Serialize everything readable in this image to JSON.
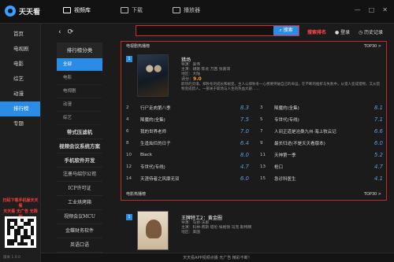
{
  "app": {
    "title": "天天看"
  },
  "nav": {
    "tabs": [
      {
        "label": "视频库",
        "active": true
      },
      {
        "label": "下载",
        "active": false
      },
      {
        "label": "播放器",
        "active": false
      }
    ]
  },
  "window": {
    "controls": [
      "—",
      "□",
      "✕"
    ]
  },
  "sidebar": {
    "items": [
      {
        "label": "首页"
      },
      {
        "label": "电视剧"
      },
      {
        "label": "电影"
      },
      {
        "label": "综艺"
      },
      {
        "label": "动漫"
      },
      {
        "label": "排行榜",
        "active": true
      },
      {
        "label": "专题"
      }
    ],
    "promo": "扫码下载手机版天天看\n天天看 无广告 无限制",
    "version": "版本 1.0.0"
  },
  "category": {
    "header": "排行榜分类",
    "items": [
      {
        "label": "全部",
        "active": true
      },
      {
        "label": "电影"
      },
      {
        "label": "电视剧"
      },
      {
        "label": "动漫"
      },
      {
        "label": "综艺"
      }
    ],
    "sub": [
      {
        "label": "带式压滤机",
        "big": true
      },
      {
        "label": "视频会议系统方案",
        "big": true
      },
      {
        "label": "手机软件开发",
        "big": true
      },
      {
        "label": "注册马绍尔公司"
      },
      {
        "label": "ICP许可证"
      },
      {
        "label": "工业烘烤箱"
      },
      {
        "label": "视频会议MCU"
      },
      {
        "label": "金蝶财务软件"
      },
      {
        "label": "英语口语"
      }
    ]
  },
  "search": {
    "placeholder": "",
    "button": "搜索",
    "hot_link": "搜索排名",
    "login": "登录",
    "history": "历史记录"
  },
  "panel": {
    "title": "电视剧热播榜",
    "top_label": "TOP30 >",
    "featured": {
      "rank": "1",
      "title": "猎场",
      "director": "导演：姜伟",
      "cast": "主演：胡歌 陈龙 万茜 张嘉译",
      "region": "地区：大陆",
      "score_label": "评分：",
      "score": "9.0",
      "desc": "职场的灵魂，郑秋冬的成长和蜕变。主人公郑秋冬一心想要突破自己的命运，在不断的挫折与失败中，从猎人变成猎物，又从猎物变成猎人，一部关于职场与人生的热血大剧……"
    },
    "rank_left": [
      {
        "num": "2",
        "name": "行尸走肉第八季",
        "score": "8.3",
        "hot": false
      },
      {
        "num": "4",
        "name": "降魔的(全集)",
        "score": "7.5",
        "hot": false
      },
      {
        "num": "6",
        "name": "我的世界老师",
        "score": "7.0",
        "hot": false
      },
      {
        "num": "8",
        "name": "生逢灿烂的日子",
        "score": "6.4",
        "hot": false
      },
      {
        "num": "10",
        "name": "Black",
        "score": "8.0",
        "hot": false
      },
      {
        "num": "12",
        "name": "专世代(专线)",
        "score": "4.7",
        "hot": false
      },
      {
        "num": "14",
        "name": "天涯侍者之风靡无双",
        "score": "6.0",
        "hot": false
      }
    ],
    "rank_right": [
      {
        "num": "3",
        "name": "降魔的(全集)",
        "score": "8.1",
        "hot": false
      },
      {
        "num": "5",
        "name": "专世代(专线)",
        "score": "7.1",
        "hot": false
      },
      {
        "num": "7",
        "name": "人间正道是沧桑九州·海上牧云记",
        "score": "6.6",
        "hot": false
      },
      {
        "num": "9",
        "name": "最长归途(不是天天看版本)",
        "score": "6.0",
        "hot": false
      },
      {
        "num": "11",
        "name": "天神第一季",
        "score": "5.2",
        "hot": false
      },
      {
        "num": "13",
        "name": "枪口",
        "score": "4.7",
        "hot": false
      },
      {
        "num": "15",
        "name": "急诊科医生",
        "score": "4.1",
        "hot": false
      }
    ],
    "foot_title": "电影热播榜",
    "foot_top": "TOP30 >"
  },
  "feature2": {
    "rank": "1",
    "title": "王牌特工2：黄金圈",
    "director": "导演：马修·沃恩",
    "cast": "主演：科林·费斯 塔伦·埃格顿 马克·斯特朗",
    "region": "地区：美国"
  },
  "ticker": "天天看APP视频点播 无广告 精彩不断！"
}
